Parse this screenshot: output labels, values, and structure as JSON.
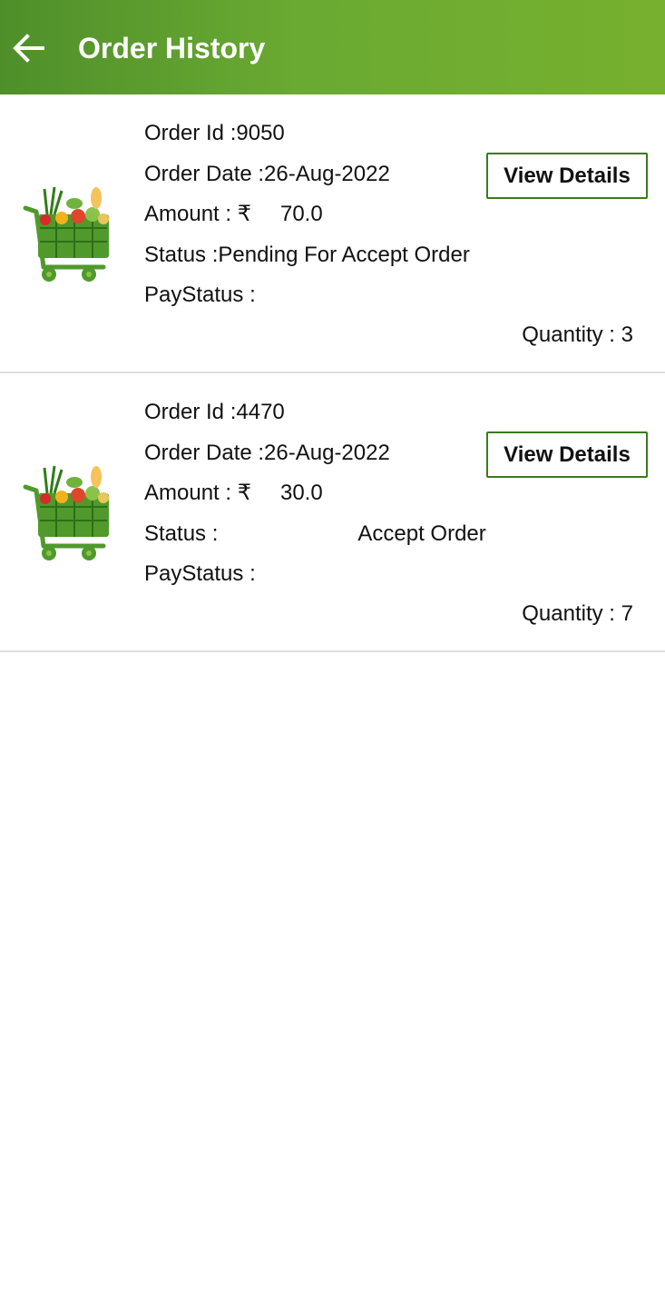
{
  "header": {
    "title": "Order History",
    "back_icon": "arrow-left-icon",
    "gradient_start": "#4f8f2a",
    "gradient_end": "#77b02e"
  },
  "orders": [
    {
      "order_id_label": "Order Id : ",
      "order_id": "9050",
      "order_date_label": "Order Date : ",
      "order_date": "26-Aug-2022",
      "amount_label": "Amount : ₹",
      "amount": "70.0",
      "status_label": "Status : ",
      "status": "Pending For Accept Order",
      "paystatus_label": "PayStatus : ",
      "paystatus": "",
      "quantity_label": "Quantity : ",
      "quantity": "3",
      "view_button": "View Details"
    },
    {
      "order_id_label": "Order Id : ",
      "order_id": "4470",
      "order_date_label": "Order Date : ",
      "order_date": "26-Aug-2022",
      "amount_label": "Amount : ₹",
      "amount": "30.0",
      "status_label": "Status : ",
      "status": "Accept Order",
      "paystatus_label": "PayStatus : ",
      "paystatus": "",
      "quantity_label": "Quantity : ",
      "quantity": "7",
      "view_button": "View Details"
    }
  ],
  "colors": {
    "accent": "#3a7a1d",
    "divider": "#dedede"
  }
}
